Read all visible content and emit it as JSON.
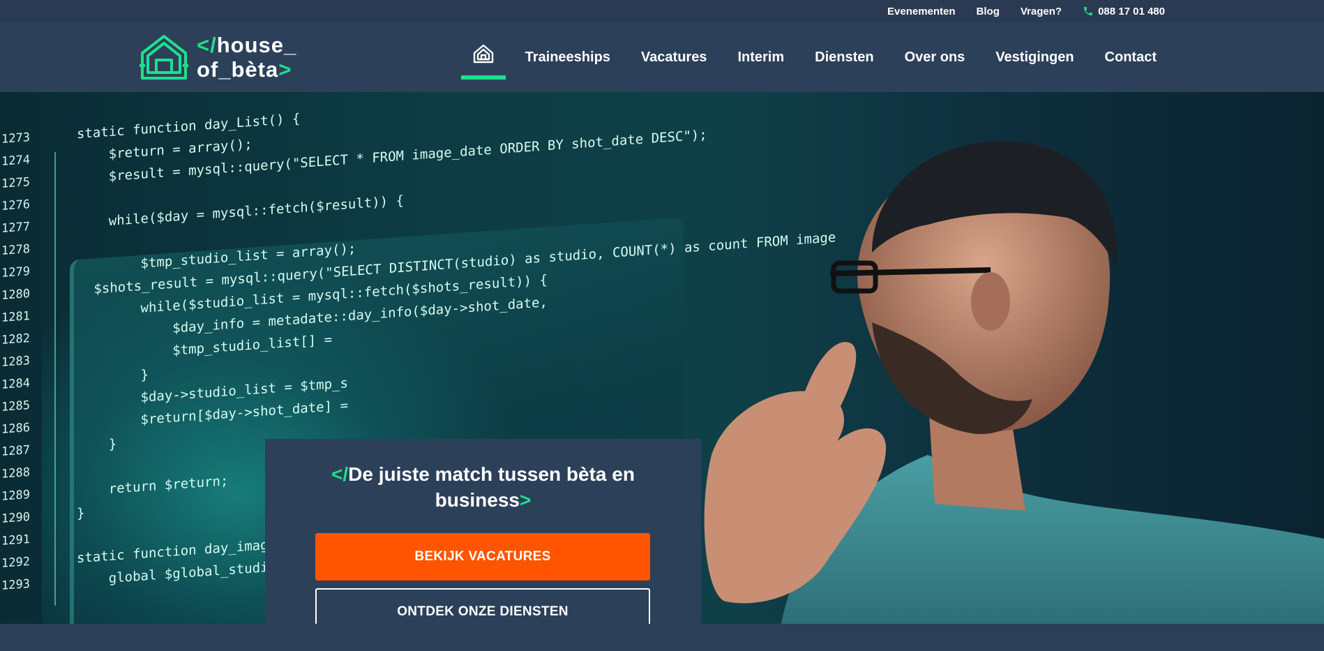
{
  "topbar": {
    "links": [
      "Evenementen",
      "Blog",
      "Vragen?"
    ],
    "phone": "088 17 01 480"
  },
  "logo": {
    "line1_prefix": "</",
    "line1_word": "house_",
    "line2_word": "of_bèta",
    "line2_suffix": ">",
    "accent_color": "#1ee08c"
  },
  "nav": {
    "home_icon": "home-icon",
    "items": [
      "Traineeships",
      "Vacatures",
      "Interim",
      "Diensten",
      "Over ons",
      "Vestigingen",
      "Contact"
    ]
  },
  "hero": {
    "code_lines": [
      {
        "n": "1273",
        "text": "static function day_List() {"
      },
      {
        "n": "1274",
        "text": "    $return = array();"
      },
      {
        "n": "1275",
        "text": "    $result = mysql::query(\"SELECT * FROM image_date ORDER BY shot_date DESC\");"
      },
      {
        "n": "1276",
        "text": ""
      },
      {
        "n": "1277",
        "text": "    while($day = mysql::fetch($result)) {"
      },
      {
        "n": "1278",
        "text": ""
      },
      {
        "n": "1279",
        "text": "        $tmp_studio_list = array();"
      },
      {
        "n": "1280",
        "text": "        $shots_result = mysql::query(\"SELECT DISTINCT(studio) as studio, COUNT(*) as count FROM image"
      },
      {
        "n": "1281",
        "text": "        while($studio_list = mysql::fetch($shots_result)) {"
      },
      {
        "n": "1282",
        "text": "            $day_info = metadate::day_info($day->shot_date,"
      },
      {
        "n": "1283",
        "text": "            $tmp_studio_list[] = "
      },
      {
        "n": "1284",
        "text": "        }"
      },
      {
        "n": "1285",
        "text": "        $day->studio_list = $tmp_s"
      },
      {
        "n": "1286",
        "text": "        $return[$day->shot_date] ="
      },
      {
        "n": "1287",
        "text": "    }"
      },
      {
        "n": "1288",
        "text": ""
      },
      {
        "n": "1289",
        "text": "    return $return;"
      },
      {
        "n": "1290",
        "text": "}"
      },
      {
        "n": "1291",
        "text": ""
      },
      {
        "n": "1292",
        "text": "static function day_images_list($"
      },
      {
        "n": "1293",
        "text": "    global $global_studio_list;"
      }
    ]
  },
  "cta": {
    "title_prefix": "</",
    "title": "De juiste match tussen bèta en business",
    "title_suffix": ">",
    "primary_label": "BEKIJK VACATURES",
    "secondary_label": "ONTDEK ONZE DIENSTEN",
    "primary_color": "#ff5400"
  }
}
